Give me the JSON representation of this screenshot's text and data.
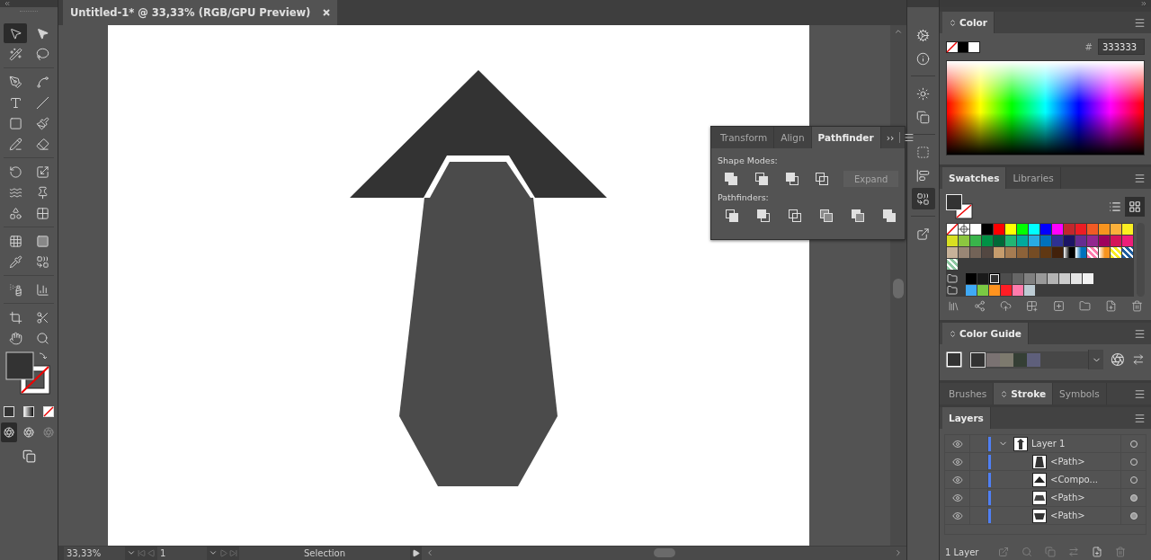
{
  "document": {
    "tab_title": "Untitled-1* @ 33,33% (RGB/GPU Preview)"
  },
  "tools": [
    {
      "selected": true
    },
    {
      "selected": false
    },
    {
      "selected": false
    },
    {
      "selected": false
    },
    {
      "selected": false
    },
    {
      "selected": false
    },
    {
      "selected": false
    },
    {
      "selected": false
    },
    {
      "selected": false
    },
    {
      "selected": false
    },
    {
      "selected": false
    },
    {
      "selected": false
    },
    {
      "selected": false
    },
    {
      "selected": false
    },
    {
      "selected": false
    },
    {
      "selected": false
    },
    {
      "selected": false
    },
    {
      "selected": false
    },
    {
      "selected": false
    },
    {
      "selected": false
    },
    {
      "selected": false
    },
    {
      "selected": false
    },
    {
      "selected": false
    },
    {
      "selected": false
    },
    {
      "selected": false
    },
    {
      "selected": false
    },
    {
      "selected": false
    },
    {
      "selected": false
    }
  ],
  "dock": [
    {
      "selected": false
    },
    {
      "selected": false
    },
    {
      "selected": false
    },
    {
      "selected": false
    },
    {
      "selected": false
    },
    {
      "selected": false
    },
    {
      "selected": true
    },
    {
      "selected": false
    }
  ],
  "color_panel": {
    "tabs": [
      {
        "label": "Color",
        "selected": true
      }
    ],
    "hash_label": "#",
    "hex": "333333"
  },
  "swatches_panel": {
    "tabs": [
      {
        "label": "Swatches",
        "selected": true
      },
      {
        "label": "Libraries",
        "selected": false
      }
    ],
    "view_modes": [
      {
        "selected": false
      },
      {
        "selected": true
      }
    ],
    "rows": [
      {
        "kind": "plain",
        "items": [
          {
            "kind": "none",
            "selected": false
          },
          {
            "kind": "registration",
            "selected": false
          },
          {
            "kind": "color",
            "color": "#ffffff",
            "selected": false
          },
          {
            "kind": "color",
            "color": "#000000",
            "selected": false
          },
          {
            "kind": "color",
            "color": "#ff0000",
            "selected": false
          },
          {
            "kind": "color",
            "color": "#ffff00",
            "selected": false
          },
          {
            "kind": "color",
            "color": "#00ff00",
            "selected": false
          },
          {
            "kind": "color",
            "color": "#00ffff",
            "selected": false
          },
          {
            "kind": "color",
            "color": "#0000ff",
            "selected": false
          },
          {
            "kind": "color",
            "color": "#ff00ff",
            "selected": false
          },
          {
            "kind": "color",
            "color": "#c1272d",
            "selected": false
          },
          {
            "kind": "color",
            "color": "#ed1c24",
            "selected": false
          },
          {
            "kind": "color",
            "color": "#f15a24",
            "selected": false
          },
          {
            "kind": "color",
            "color": "#f7931e",
            "selected": false
          },
          {
            "kind": "color",
            "color": "#fbb03b",
            "selected": false
          },
          {
            "kind": "color",
            "color": "#fcee21",
            "selected": false
          }
        ]
      },
      {
        "kind": "plain",
        "items": [
          {
            "kind": "color",
            "color": "#d9e021",
            "selected": false
          },
          {
            "kind": "color",
            "color": "#8cc63f",
            "selected": false
          },
          {
            "kind": "color",
            "color": "#39b54a",
            "selected": false
          },
          {
            "kind": "color",
            "color": "#009245",
            "selected": false
          },
          {
            "kind": "color",
            "color": "#006837",
            "selected": false
          },
          {
            "kind": "color",
            "color": "#22b573",
            "selected": false
          },
          {
            "kind": "color",
            "color": "#00a99d",
            "selected": false
          },
          {
            "kind": "color",
            "color": "#29abe2",
            "selected": false
          },
          {
            "kind": "color",
            "color": "#0071bc",
            "selected": false
          },
          {
            "kind": "color",
            "color": "#2e3192",
            "selected": false
          },
          {
            "kind": "color",
            "color": "#1b1464",
            "selected": false
          },
          {
            "kind": "color",
            "color": "#662d91",
            "selected": false
          },
          {
            "kind": "color",
            "color": "#93278f",
            "selected": false
          },
          {
            "kind": "color",
            "color": "#9e005d",
            "selected": false
          },
          {
            "kind": "color",
            "color": "#d4145a",
            "selected": false
          },
          {
            "kind": "color",
            "color": "#ed1e79",
            "selected": false
          }
        ]
      },
      {
        "kind": "plain",
        "items": [
          {
            "kind": "color",
            "color": "#c7b299",
            "selected": false
          },
          {
            "kind": "color",
            "color": "#998675",
            "selected": false
          },
          {
            "kind": "color",
            "color": "#736357",
            "selected": false
          },
          {
            "kind": "color",
            "color": "#534741",
            "selected": false
          },
          {
            "kind": "color",
            "color": "#c69c6d",
            "selected": false
          },
          {
            "kind": "color",
            "color": "#a67c52",
            "selected": false
          },
          {
            "kind": "color",
            "color": "#8c6239",
            "selected": false
          },
          {
            "kind": "color",
            "color": "#754c24",
            "selected": false
          },
          {
            "kind": "color",
            "color": "#603813",
            "selected": false
          },
          {
            "kind": "color",
            "color": "#42210b",
            "selected": false
          },
          {
            "kind": "gradient",
            "color": "#000000",
            "selected": false
          },
          {
            "kind": "gradient",
            "color": "#0071bc",
            "selected": false
          },
          {
            "kind": "pattern",
            "color": "#ff7bac",
            "selected": false
          },
          {
            "kind": "gradient",
            "color": "#f7931e",
            "selected": false
          },
          {
            "kind": "pattern",
            "color": "#fcee21",
            "selected": false
          },
          {
            "kind": "pattern",
            "color": "#1d5c9e",
            "selected": false
          }
        ]
      },
      {
        "kind": "plain",
        "items": [
          {
            "kind": "pattern",
            "color": "#8cc6a0",
            "selected": false
          }
        ]
      },
      {
        "kind": "group",
        "items": [
          {
            "kind": "color",
            "color": "#000000",
            "selected": false
          },
          {
            "kind": "color",
            "color": "#1a1a1a",
            "selected": false
          },
          {
            "kind": "color",
            "color": "#333333",
            "selected": true
          },
          {
            "kind": "color",
            "color": "#4d4d4d",
            "selected": false
          },
          {
            "kind": "color",
            "color": "#666666",
            "selected": false
          },
          {
            "kind": "color",
            "color": "#808080",
            "selected": false
          },
          {
            "kind": "color",
            "color": "#999999",
            "selected": false
          },
          {
            "kind": "color",
            "color": "#b3b3b3",
            "selected": false
          },
          {
            "kind": "color",
            "color": "#cccccc",
            "selected": false
          },
          {
            "kind": "color",
            "color": "#e6e6e6",
            "selected": false
          },
          {
            "kind": "color",
            "color": "#f2f2f2",
            "selected": false
          }
        ]
      },
      {
        "kind": "group",
        "items": [
          {
            "kind": "color",
            "color": "#3fa9f5",
            "selected": false
          },
          {
            "kind": "color",
            "color": "#7ac943",
            "selected": false
          },
          {
            "kind": "color",
            "color": "#ff931e",
            "selected": false
          },
          {
            "kind": "color",
            "color": "#ff1d25",
            "selected": false
          },
          {
            "kind": "color",
            "color": "#ff7bac",
            "selected": false
          },
          {
            "kind": "color",
            "color": "#bdccd4",
            "selected": false
          }
        ]
      }
    ]
  },
  "color_guide": {
    "tabs": [
      {
        "label": "Color Guide",
        "selected": true
      }
    ],
    "harmony": [
      {
        "color": "#333333",
        "selected": true
      },
      {
        "color": "#7a7272",
        "selected": false
      },
      {
        "color": "#7d7a6e",
        "selected": false
      },
      {
        "color": "#353f35",
        "selected": false
      },
      {
        "color": "#5e5f7b",
        "selected": false
      }
    ]
  },
  "stroke_group": {
    "tabs": [
      {
        "label": "Brushes",
        "selected": false
      },
      {
        "label": "Stroke",
        "selected": true
      },
      {
        "label": "Symbols",
        "selected": false
      }
    ]
  },
  "layers_panel": {
    "tabs": [
      {
        "label": "Layers",
        "selected": true
      }
    ],
    "layers": [
      {
        "name": "Layer 1",
        "visible": true,
        "expanded": true,
        "appearance": false,
        "children": [
          {
            "name": "<Path>",
            "visible": true,
            "appearance": false
          },
          {
            "name": "<Compo...",
            "visible": true,
            "appearance": false
          },
          {
            "name": "<Path>",
            "visible": true,
            "appearance": true
          },
          {
            "name": "<Path>",
            "visible": true,
            "appearance": true
          }
        ]
      }
    ],
    "footer": "1 Layer"
  },
  "pathfinder": {
    "tabs": [
      {
        "label": "Transform",
        "selected": false
      },
      {
        "label": "Align",
        "selected": false
      },
      {
        "label": "Pathfinder",
        "selected": true
      }
    ],
    "more": "››",
    "sections": [
      {
        "label": "Shape Modes:"
      },
      {
        "label": "Pathfinders:"
      }
    ],
    "expand": {
      "label": "Expand",
      "disabled": true
    }
  },
  "status": {
    "zoom": "33,33%",
    "artboard": "1",
    "tool": "Selection"
  }
}
